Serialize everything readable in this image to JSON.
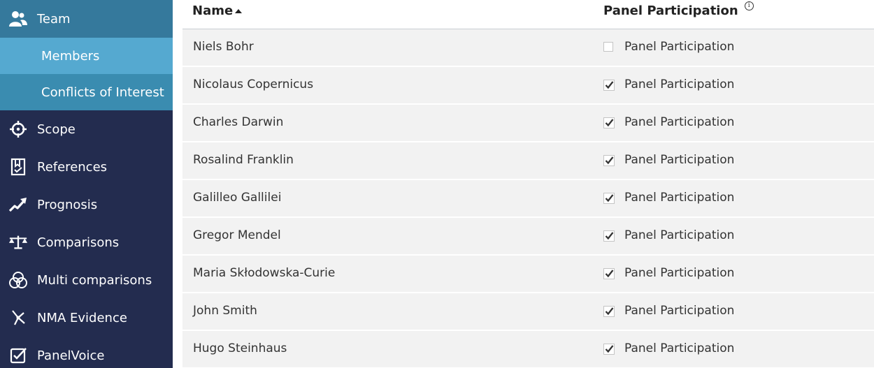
{
  "sidebar": {
    "items": [
      {
        "label": "Team",
        "icon": "team-icon"
      },
      {
        "label": "Members"
      },
      {
        "label": "Conflicts of Interest"
      },
      {
        "label": "Scope",
        "icon": "scope-icon"
      },
      {
        "label": "References",
        "icon": "references-icon"
      },
      {
        "label": "Prognosis",
        "icon": "prognosis-icon"
      },
      {
        "label": "Comparisons",
        "icon": "comparisons-icon"
      },
      {
        "label": "Multi comparisons",
        "icon": "multi-comparisons-icon"
      },
      {
        "label": "NMA Evidence",
        "icon": "nma-evidence-icon"
      },
      {
        "label": "PanelVoice",
        "icon": "panelvoice-icon"
      }
    ]
  },
  "table": {
    "columns": {
      "name": "Name",
      "participation": "Panel Participation"
    },
    "rows": [
      {
        "name": "Niels Bohr",
        "participation_label": "Panel Participation",
        "checked": false
      },
      {
        "name": "Nicolaus Copernicus",
        "participation_label": "Panel Participation",
        "checked": true
      },
      {
        "name": "Charles Darwin",
        "participation_label": "Panel Participation",
        "checked": true
      },
      {
        "name": "Rosalind Franklin",
        "participation_label": "Panel Participation",
        "checked": true
      },
      {
        "name": "Galilleo Gallilei",
        "participation_label": "Panel Participation",
        "checked": true
      },
      {
        "name": "Gregor Mendel",
        "participation_label": "Panel Participation",
        "checked": true
      },
      {
        "name": "Maria Skłodowska-Curie",
        "participation_label": "Panel Participation",
        "checked": true
      },
      {
        "name": "John Smith",
        "participation_label": "Panel Participation",
        "checked": true
      },
      {
        "name": "Hugo Steinhaus",
        "participation_label": "Panel Participation",
        "checked": true
      }
    ]
  },
  "colors": {
    "sidebar_bg": "#232c4f",
    "team_active": "#35799c",
    "members_active": "#55a9d0",
    "subitem_bg": "#3a8cb0",
    "row_bg": "#f2f2f2"
  }
}
